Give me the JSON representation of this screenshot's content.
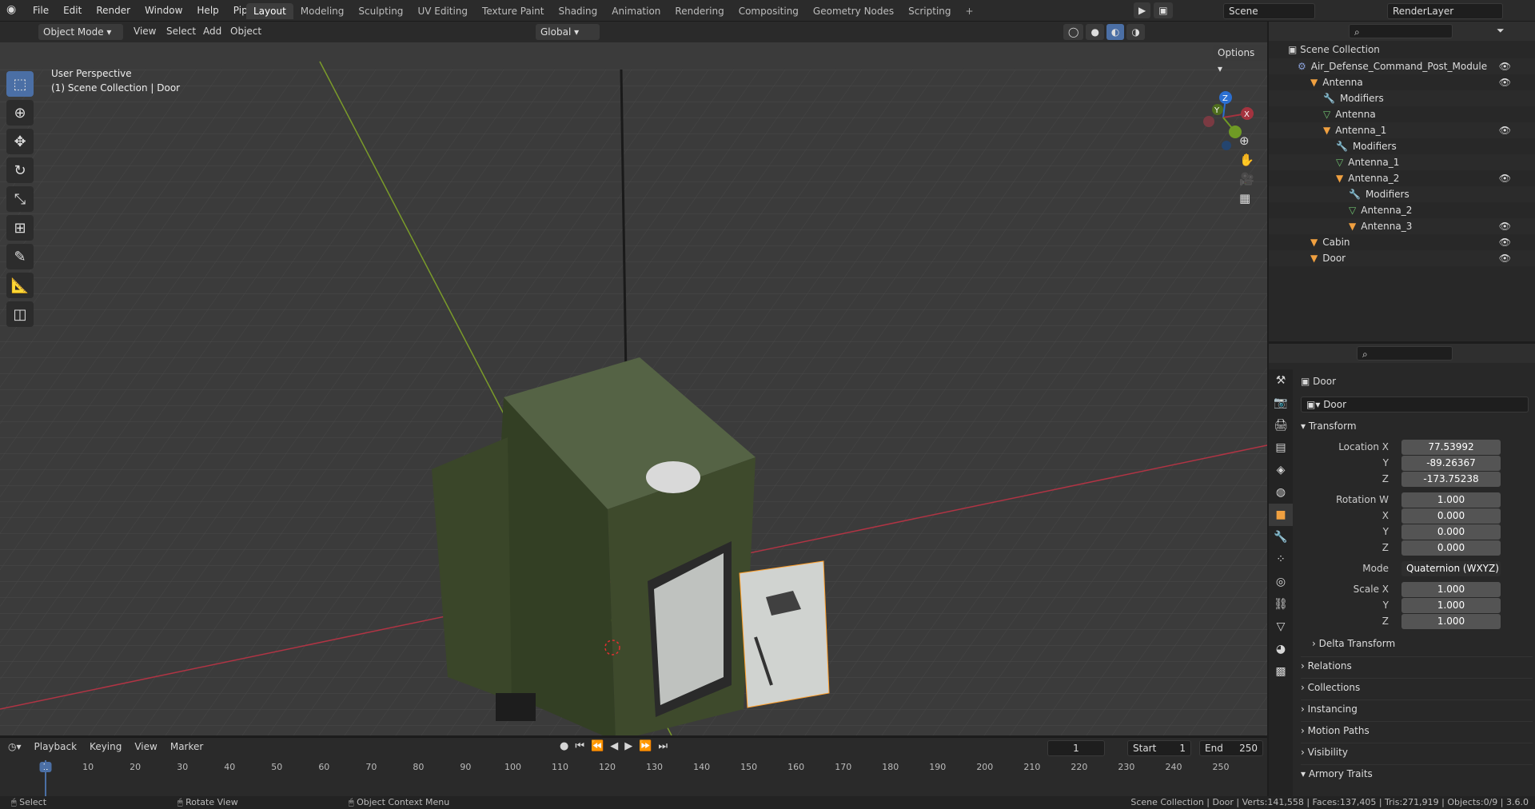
{
  "menu": [
    "File",
    "Edit",
    "Render",
    "Window",
    "Help",
    "Pipeline"
  ],
  "workspaces": [
    "Layout",
    "Modeling",
    "Sculpting",
    "UV Editing",
    "Texture Paint",
    "Shading",
    "Animation",
    "Rendering",
    "Compositing",
    "Geometry Nodes",
    "Scripting"
  ],
  "active_workspace": "Layout",
  "scene_name": "Scene",
  "render_layer": "RenderLayer",
  "viewport": {
    "mode": "Object Mode",
    "menus": [
      "View",
      "Select",
      "Add",
      "Object"
    ],
    "transform_orientation": "Global",
    "options_label": "Options",
    "overlay_line1": "User Perspective",
    "overlay_line2": "(1) Scene Collection | Door",
    "gizmo": {
      "x": "X",
      "y": "Y",
      "z": "Z"
    }
  },
  "outliner": {
    "root": "Scene Collection",
    "items": [
      {
        "label": "Air_Defense_Command_Post_Module",
        "depth": 1,
        "icon": "empty-icon"
      },
      {
        "label": "Antenna",
        "depth": 2,
        "icon": "object-icon"
      },
      {
        "label": "Modifiers",
        "depth": 3,
        "icon": "wrench-icon"
      },
      {
        "label": "Antenna",
        "depth": 3,
        "icon": "mesh-icon"
      },
      {
        "label": "Antenna_1",
        "depth": 3,
        "icon": "object-icon"
      },
      {
        "label": "Modifiers",
        "depth": 4,
        "icon": "wrench-icon"
      },
      {
        "label": "Antenna_1",
        "depth": 4,
        "icon": "mesh-icon"
      },
      {
        "label": "Antenna_2",
        "depth": 4,
        "icon": "object-icon"
      },
      {
        "label": "Modifiers",
        "depth": 5,
        "icon": "wrench-icon"
      },
      {
        "label": "Antenna_2",
        "depth": 5,
        "icon": "mesh-icon"
      },
      {
        "label": "Antenna_3",
        "depth": 5,
        "icon": "object-icon"
      },
      {
        "label": "Cabin",
        "depth": 2,
        "icon": "object-icon"
      },
      {
        "label": "Door",
        "depth": 2,
        "icon": "object-icon"
      }
    ]
  },
  "properties": {
    "object_name": "Door",
    "datablock_name": "Door",
    "transform_label": "Transform",
    "location_label": "Location X",
    "location": {
      "x": "77.53992",
      "y": "-89.26367",
      "z": "-173.75238"
    },
    "rotation_label": "Rotation W",
    "rotation": {
      "w": "1.000",
      "x": "0.000",
      "y": "0.000",
      "z": "0.000"
    },
    "mode_label": "Mode",
    "mode_value": "Quaternion (WXYZ)",
    "scale_label": "Scale X",
    "scale": {
      "x": "1.000",
      "y": "1.000",
      "z": "1.000"
    },
    "axis": {
      "x": "X",
      "y": "Y",
      "z": "Z"
    },
    "sections": [
      "Delta Transform",
      "Relations",
      "Collections",
      "Instancing",
      "Motion Paths",
      "Visibility",
      "Armory Traits"
    ]
  },
  "timeline": {
    "menus": [
      "Playback",
      "Keying",
      "View",
      "Marker"
    ],
    "current_frame": "1",
    "start_label": "Start",
    "start": "1",
    "end_label": "End",
    "end": "250",
    "ticks": [
      "1",
      "10",
      "20",
      "30",
      "40",
      "50",
      "60",
      "70",
      "80",
      "90",
      "100",
      "110",
      "120",
      "130",
      "140",
      "150",
      "160",
      "170",
      "180",
      "190",
      "200",
      "210",
      "220",
      "230",
      "240",
      "250"
    ]
  },
  "status": {
    "left": [
      "Select",
      "Rotate View",
      "Object Context Menu"
    ],
    "right": "Scene Collection | Door | Verts:141,558 | Faces:137,405 | Tris:271,919 | Objects:0/9 | 3.6.0"
  },
  "colors": {
    "accent": "#4b6fa5",
    "x_axis": "#a4333f",
    "y_axis": "#6f9a25",
    "z_axis": "#2b6fd1",
    "mesh_body": "#3e4a2c",
    "door_panel": "#c9ccc9"
  }
}
